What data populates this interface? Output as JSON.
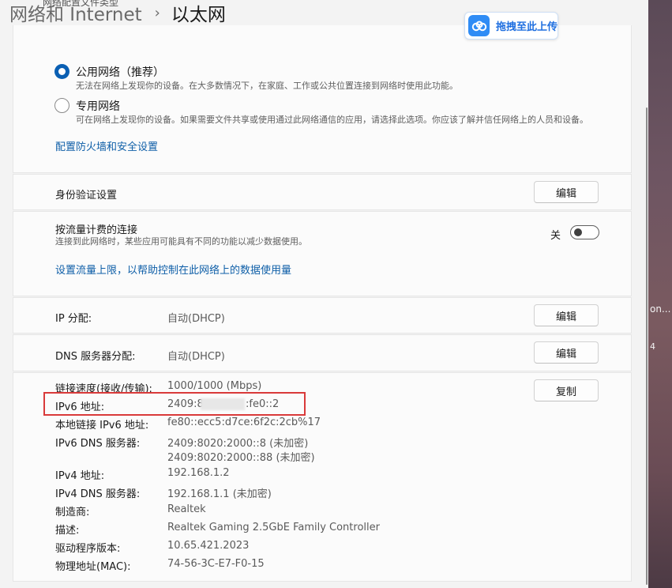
{
  "header": {
    "breadcrumb_parent": "网络和 Internet",
    "breadcrumb_separator": "›",
    "breadcrumb_current": "以太网"
  },
  "upload": {
    "label": "拖拽至此上传",
    "icon": "cloud-icon",
    "color": "#2f8cf5"
  },
  "profile": {
    "section_title": "网络配置文件类型",
    "options": [
      {
        "title": "公用网络（推荐）",
        "description": "无法在网络上发现你的设备。在大多数情况下，在家庭、工作或公共位置连接到网络时使用此功能。",
        "selected": true
      },
      {
        "title": "专用网络",
        "description": "可在网络上发现你的设备。如果需要文件共享或使用通过此网络通信的应用，请选择此选项。你应该了解并信任网络上的人员和设备。",
        "selected": false
      }
    ],
    "firewall_link": "配置防火墙和安全设置"
  },
  "auth": {
    "label": "身份验证设置",
    "button": "编辑"
  },
  "metered": {
    "title": "按流量计费的连接",
    "description": "连接到此网络时，某些应用可能具有不同的功能以减少数据使用。",
    "toggle_state": "关",
    "toggle_on": false,
    "data_limit_link": "设置流量上限，以帮助控制在此网络上的数据使用量"
  },
  "ip_assignment": {
    "label": "IP 分配:",
    "value": "自动(DHCP)",
    "button": "编辑"
  },
  "dns_assignment": {
    "label": "DNS 服务器分配:",
    "value": "自动(DHCP)",
    "button": "编辑"
  },
  "details": {
    "copy_button": "复制",
    "link_speed": {
      "label": "链接速度(接收/传输):",
      "value": "1000/1000 (Mbps)"
    },
    "ipv6": {
      "label": "IPv6 地址:",
      "value_prefix": "2409:8a",
      "value_suffix": ":fe0::2"
    },
    "link_local_ipv6": {
      "label": "本地链接 IPv6 地址:",
      "value": "fe80::ecc5:d7ce:6f2c:2cb%17"
    },
    "ipv6_dns": {
      "label": "IPv6 DNS 服务器:",
      "value_1": "2409:8020:2000::8 (未加密)",
      "value_2": "2409:8020:2000::88 (未加密)"
    },
    "ipv4": {
      "label": "IPv4 地址:",
      "value": "192.168.1.2"
    },
    "ipv4_dns": {
      "label": "IPv4 DNS 服务器:",
      "value": "192.168.1.1 (未加密)"
    },
    "manufacturer": {
      "label": "制造商:",
      "value": "Realtek"
    },
    "description": {
      "label": "描述:",
      "value": "Realtek Gaming 2.5GbE Family Controller"
    },
    "driver_version": {
      "label": "驱动程序版本:",
      "value": "10.65.421.2023"
    },
    "mac": {
      "label": "物理地址(MAC):",
      "value": "74-56-3C-E7-F0-15"
    }
  },
  "background_window": {
    "text_1": "on...",
    "text_2": "4"
  },
  "colors": {
    "accent": "#0a5fb3",
    "link": "#0f5fa8",
    "highlight_box": "#d93a3a"
  }
}
